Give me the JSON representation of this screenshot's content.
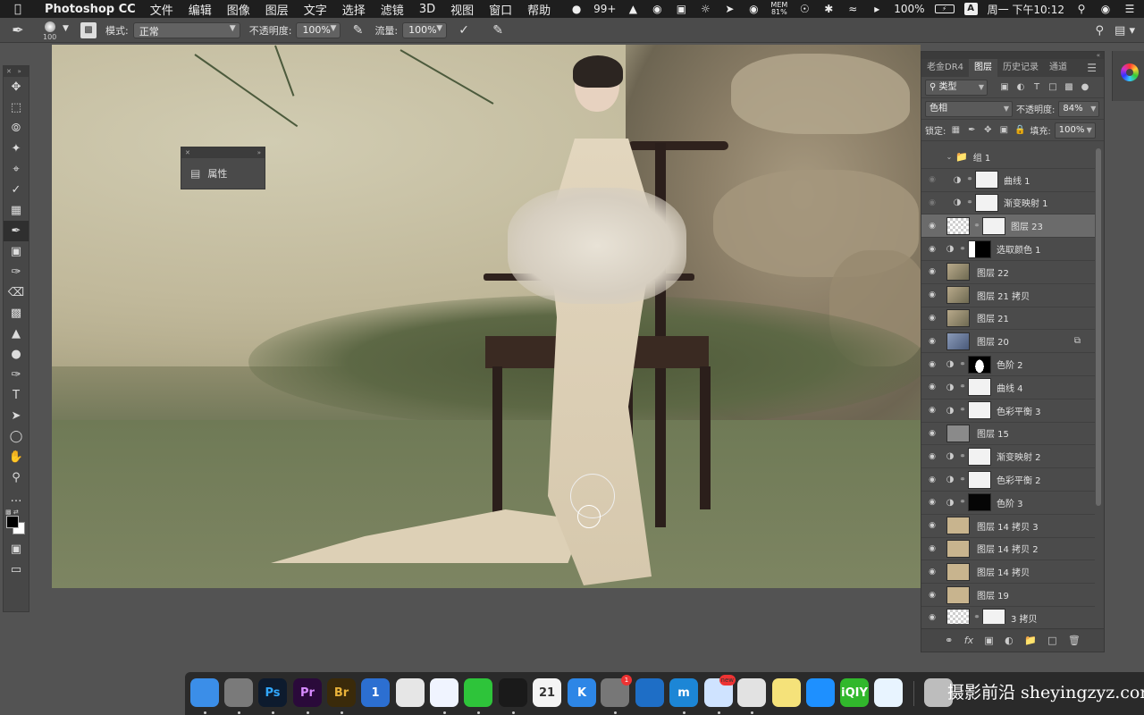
{
  "menubar": {
    "app_name": "Photoshop CC",
    "menus": [
      "文件",
      "编辑",
      "图像",
      "图层",
      "文字",
      "选择",
      "滤镜",
      "3D",
      "视图",
      "窗口",
      "帮助"
    ],
    "wechat_badge": "99+",
    "mem_label": "MEM",
    "mem_value": "81%",
    "battery_text": "100%",
    "input_method": "A",
    "datetime": "周一 下午10:12"
  },
  "options_bar": {
    "brush_size": "100",
    "mode_label": "模式:",
    "mode_value": "正常",
    "opacity_label": "不透明度:",
    "opacity_value": "100%",
    "flow_label": "流量:",
    "flow_value": "100%"
  },
  "properties_panel": {
    "title": "属性"
  },
  "layers_panel": {
    "tabs": [
      "老金DR4",
      "图层",
      "历史记录",
      "通道"
    ],
    "active_tab": "图层",
    "filter_kind": "类型",
    "blend_mode": "色相",
    "opacity_label": "不透明度:",
    "opacity_value": "84%",
    "lock_label": "锁定:",
    "fill_label": "填充:",
    "fill_value": "100%",
    "group_name": "组 1",
    "layers": [
      {
        "name": "曲线 1",
        "kind": "adjustment",
        "visible": false,
        "in_group": true,
        "mask": "white"
      },
      {
        "name": "渐变映射 1",
        "kind": "adjustment",
        "visible": false,
        "in_group": true,
        "mask": "white"
      },
      {
        "name": "图层 23",
        "kind": "pixel-mask",
        "visible": true,
        "selected": true,
        "thumb": "checker",
        "mask": "white"
      },
      {
        "name": "选取颜色 1",
        "kind": "adjustment",
        "visible": true,
        "mask": "black-white"
      },
      {
        "name": "图层 22",
        "kind": "pixel",
        "visible": true,
        "thumb": "photo"
      },
      {
        "name": "图层 21 拷贝",
        "kind": "pixel",
        "visible": true,
        "thumb": "photo"
      },
      {
        "name": "图层 21",
        "kind": "pixel",
        "visible": true,
        "thumb": "photo"
      },
      {
        "name": "图层 20",
        "kind": "smart",
        "visible": true,
        "thumb": "photo-blue"
      },
      {
        "name": "色阶 2",
        "kind": "adjustment",
        "visible": true,
        "mask": "black-figure"
      },
      {
        "name": "曲线 4",
        "kind": "adjustment",
        "visible": true,
        "mask": "white"
      },
      {
        "name": "色彩平衡 3",
        "kind": "adjustment",
        "visible": true,
        "mask": "white"
      },
      {
        "name": "图层 15",
        "kind": "pixel",
        "visible": true,
        "thumb": "gray"
      },
      {
        "name": "渐变映射 2",
        "kind": "adjustment",
        "visible": true,
        "mask": "white"
      },
      {
        "name": "色彩平衡 2",
        "kind": "adjustment",
        "visible": true,
        "mask": "white"
      },
      {
        "name": "色阶 3",
        "kind": "adjustment",
        "visible": true,
        "mask": "black"
      },
      {
        "name": "图层 14 拷贝 3",
        "kind": "pixel",
        "visible": true,
        "thumb": "tan"
      },
      {
        "name": "图层 14 拷贝 2",
        "kind": "pixel",
        "visible": true,
        "thumb": "tan"
      },
      {
        "name": "图层 14 拷贝",
        "kind": "pixel",
        "visible": true,
        "thumb": "tan"
      },
      {
        "name": "图层 19",
        "kind": "pixel",
        "visible": true,
        "thumb": "tan"
      },
      {
        "name": "3 拷贝",
        "kind": "pixel-mask",
        "visible": true,
        "thumb": "checker",
        "mask": "white"
      }
    ]
  },
  "dock": {
    "apps": [
      {
        "name": "Finder",
        "label": "",
        "color": "#3b8ee8"
      },
      {
        "name": "Launchpad",
        "label": "",
        "color": "#7a7a7a"
      },
      {
        "name": "Photoshop",
        "label": "Ps",
        "color": "#0d1b2e"
      },
      {
        "name": "Premiere",
        "label": "Pr",
        "color": "#2a0a3a"
      },
      {
        "name": "Bridge",
        "label": "Br",
        "color": "#3a2a0a"
      },
      {
        "name": "1Password",
        "label": "1",
        "color": "#2c6fd1"
      },
      {
        "name": "Prism",
        "label": "",
        "color": "#e6e6e6"
      },
      {
        "name": "Baidu Netdisk",
        "label": "",
        "color": "#f0f4ff"
      },
      {
        "name": "WeChat",
        "label": "",
        "color": "#2ec43a"
      },
      {
        "name": "QQ",
        "label": "",
        "color": "#1a1a1a"
      },
      {
        "name": "Calendar",
        "label": "21",
        "color": "#f4f4f4"
      },
      {
        "name": "Kuaishou",
        "label": "K",
        "color": "#2d86e6"
      },
      {
        "name": "System Preferences",
        "label": "",
        "color": "#777777",
        "badge": "1"
      },
      {
        "name": "Edge",
        "label": "",
        "color": "#1e6ec6"
      },
      {
        "name": "Maxthon",
        "label": "m",
        "color": "#1c86d6"
      },
      {
        "name": "Mail",
        "label": "",
        "color": "#cfe3ff",
        "badge": "new"
      },
      {
        "name": "Chrome",
        "label": "",
        "color": "#e2e2e2"
      },
      {
        "name": "Notes",
        "label": "",
        "color": "#f5e27a"
      },
      {
        "name": "Tencent Video",
        "label": "",
        "color": "#1e90ff"
      },
      {
        "name": "iQIYI",
        "label": "iQIY",
        "color": "#31b82c"
      },
      {
        "name": "Clean",
        "label": "",
        "color": "#e8f4ff"
      },
      {
        "name": "Trash",
        "label": "",
        "color": "#bdbdbd"
      }
    ],
    "watermark": "摄影前沿 sheyingzyz.com"
  }
}
